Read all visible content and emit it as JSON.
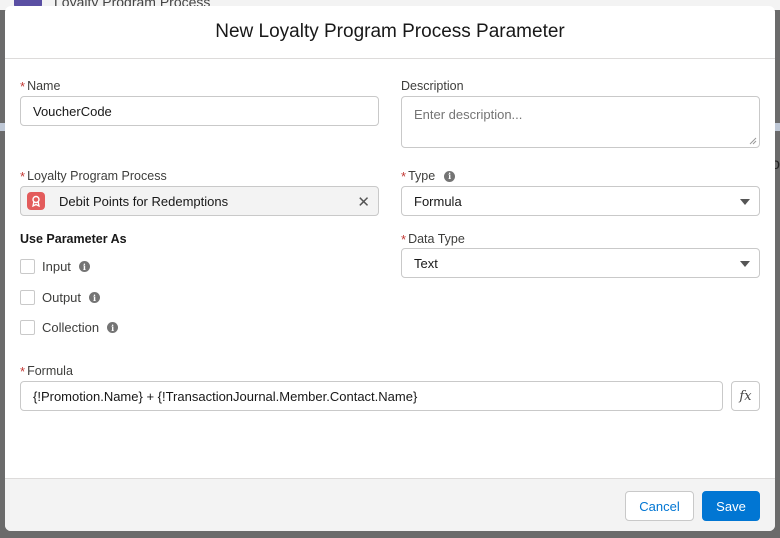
{
  "background": {
    "page_title": "Loyalty Program Process",
    "side_char": "o"
  },
  "modal": {
    "title": "New Loyalty Program Process Parameter"
  },
  "fields": {
    "name": {
      "label": "Name",
      "required": "*",
      "value": "VoucherCode"
    },
    "description": {
      "label": "Description",
      "placeholder": "Enter description..."
    },
    "process": {
      "label": "Loyalty Program Process",
      "required": "*",
      "value": "Debit Points for Redemptions",
      "clear_glyph": "✕"
    },
    "type": {
      "label": "Type",
      "required": "*",
      "value": "Formula",
      "info_glyph": "i"
    },
    "data_type": {
      "label": "Data Type",
      "required": "*",
      "value": "Text"
    },
    "formula": {
      "label": "Formula",
      "required": "*",
      "value": "{!Promotion.Name} + {!TransactionJournal.Member.Contact.Name}",
      "fx_glyph": "fx"
    }
  },
  "use_parameter_as": {
    "heading": "Use Parameter As",
    "options": [
      {
        "label": "Input",
        "checked": false,
        "info_glyph": "i"
      },
      {
        "label": "Output",
        "checked": false,
        "info_glyph": "i"
      },
      {
        "label": "Collection",
        "checked": false,
        "info_glyph": "i"
      }
    ]
  },
  "footer": {
    "cancel_label": "Cancel",
    "save_label": "Save"
  },
  "colors": {
    "brand": "#0176d3",
    "required": "#c23934",
    "lookup_badge": "#e35c5c"
  },
  "icons": {
    "process_badge": "loyalty-process-icon",
    "clear": "close-icon",
    "caret": "chevron-down-icon",
    "info": "info-icon",
    "formula": "function-icon"
  }
}
